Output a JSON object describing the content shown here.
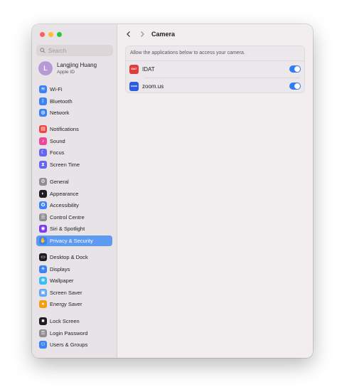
{
  "sidebar": {
    "search_placeholder": "Search",
    "account": {
      "initial": "L",
      "name": "Langjing Huang",
      "subtitle": "Apple ID"
    },
    "groups": [
      [
        {
          "label": "Wi-Fi",
          "icon": "wifi-icon",
          "color": "#3b82f6",
          "glyph": "≋"
        },
        {
          "label": "Bluetooth",
          "icon": "bluetooth-icon",
          "color": "#3b82f6",
          "glyph": "ᛒ"
        },
        {
          "label": "Network",
          "icon": "network-icon",
          "color": "#3b82f6",
          "glyph": "◍"
        }
      ],
      [
        {
          "label": "Notifications",
          "icon": "notifications-icon",
          "color": "#ef4444",
          "glyph": "▤"
        },
        {
          "label": "Sound",
          "icon": "sound-icon",
          "color": "#ec4899",
          "glyph": "♪"
        },
        {
          "label": "Focus",
          "icon": "focus-icon",
          "color": "#6366f1",
          "glyph": "☾"
        },
        {
          "label": "Screen Time",
          "icon": "screen-time-icon",
          "color": "#6366f1",
          "glyph": "⧗"
        }
      ],
      [
        {
          "label": "General",
          "icon": "general-icon",
          "color": "#8e8e93",
          "glyph": "⚙"
        },
        {
          "label": "Appearance",
          "icon": "appearance-icon",
          "color": "#1d1d1f",
          "glyph": "◐"
        },
        {
          "label": "Accessibility",
          "icon": "accessibility-icon",
          "color": "#3b82f6",
          "glyph": "✪"
        },
        {
          "label": "Control Centre",
          "icon": "control-centre-icon",
          "color": "#8e8e93",
          "glyph": "☰"
        },
        {
          "label": "Siri & Spotlight",
          "icon": "siri-icon",
          "color": "#7c3aed",
          "glyph": "◉"
        },
        {
          "label": "Privacy & Security",
          "icon": "privacy-hand-icon",
          "color": "#3b82f6",
          "glyph": "✋",
          "selected": true
        }
      ],
      [
        {
          "label": "Desktop & Dock",
          "icon": "desktop-dock-icon",
          "color": "#1d1d1f",
          "glyph": "▭"
        },
        {
          "label": "Displays",
          "icon": "displays-icon",
          "color": "#3b82f6",
          "glyph": "☀"
        },
        {
          "label": "Wallpaper",
          "icon": "wallpaper-icon",
          "color": "#38bdf8",
          "glyph": "❀"
        },
        {
          "label": "Screen Saver",
          "icon": "screen-saver-icon",
          "color": "#60a5fa",
          "glyph": "▣"
        },
        {
          "label": "Energy Saver",
          "icon": "energy-saver-icon",
          "color": "#f59e0b",
          "glyph": "●"
        }
      ],
      [
        {
          "label": "Lock Screen",
          "icon": "lock-screen-icon",
          "color": "#1d1d1f",
          "glyph": "■"
        },
        {
          "label": "Login Password",
          "icon": "login-password-icon",
          "color": "#8e8e93",
          "glyph": "⚿"
        },
        {
          "label": "Users & Groups",
          "icon": "users-groups-icon",
          "color": "#3b82f6",
          "glyph": "⚇"
        }
      ]
    ]
  },
  "main": {
    "title": "Camera",
    "description": "Allow the applications below to access your camera.",
    "apps": [
      {
        "name": "IDAT",
        "icon_text": "IDAT",
        "icon_color": "#e23b3b",
        "enabled": true
      },
      {
        "name": "zoom.us",
        "icon_text": "zoom",
        "icon_color": "#2d5be3",
        "enabled": true
      }
    ]
  }
}
